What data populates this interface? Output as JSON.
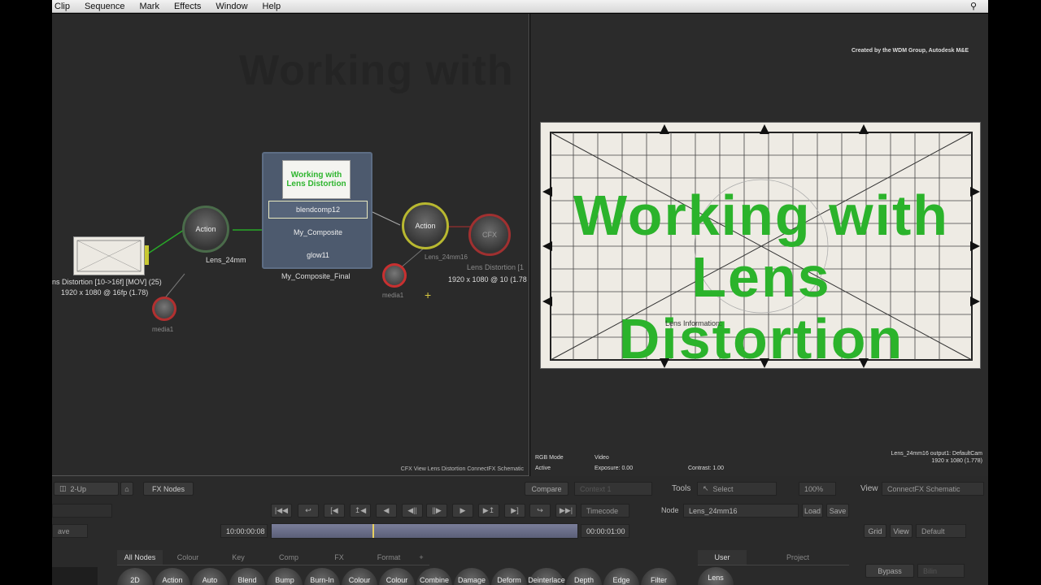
{
  "menu": [
    "Clip",
    "Sequence",
    "Mark",
    "Effects",
    "Window",
    "Help"
  ],
  "ghost_title": "Working with Lens Distortion",
  "credit": "Created by the WDM Group, Autodesk M&E",
  "schematic": {
    "source_label": "ns Distortion [10->16f] [MOV] (25)",
    "source_res": "1920 x 1080 @ 16fp (1.78)",
    "action1": "Action",
    "action1_label": "Lens_24mm",
    "media1": "media1",
    "composite_rows": [
      "blendcomp12",
      "My_Composite",
      "glow11"
    ],
    "composite_label": "My_Composite_Final",
    "thumb_text": "Working with Lens Distortion",
    "action2": "Action",
    "action2_label": "Lens_24mm16",
    "media2": "media1",
    "cfx": "CFX",
    "output_label": "Lens Distortion [1",
    "output_res": "1920 x 1080 @ 10 (1.78",
    "footer": "CFX View Lens Distortion ConnectFX Schematic"
  },
  "viewer": {
    "overlay_line1": "Working with",
    "overlay_line2": "Lens Distortion",
    "lens_info": "Lens Information:",
    "status_left1": "RGB Mode",
    "status_left2": "Active",
    "status_mid1": "Video",
    "status_mid2": "Exposure: 0.00",
    "status_right": "Contrast: 1.00",
    "cam_line1": "Lens_24mm16 output1: DefaultCam",
    "cam_line2": "1920 x 1080 (1.778)"
  },
  "toolbar": {
    "layout": "2-Up",
    "fxnodes": "FX Nodes",
    "compare": "Compare",
    "compare_value": "Context 1",
    "tools": "Tools",
    "select": "Select",
    "zoom": "100%",
    "view": "View",
    "view_value": "ConnectFX Schematic",
    "timecode": "Timecode",
    "node": "Node",
    "node_value": "Lens_24mm16",
    "load": "Load",
    "save": "Save",
    "save_left": "ave",
    "tc_start": "10:00:00:08",
    "tc_end": "00:00:01:00",
    "grid": "Grid",
    "view2": "View",
    "default": "Default"
  },
  "bottom_tabs": [
    "All Nodes",
    "Colour",
    "Key",
    "Comp",
    "FX",
    "Format",
    "+"
  ],
  "right_tabs": [
    "User",
    "Project"
  ],
  "bypass": "Bypass",
  "bypass_value": "Bilin",
  "node_buttons": [
    "2D",
    "Action",
    "Auto",
    "Blend",
    "Bump",
    "Burn-In",
    "Colour",
    "Colour",
    "Combine",
    "Damage",
    "Deform",
    "Deinterlace",
    "Depth",
    "Edge",
    "Filter"
  ],
  "user_button": "Lens"
}
